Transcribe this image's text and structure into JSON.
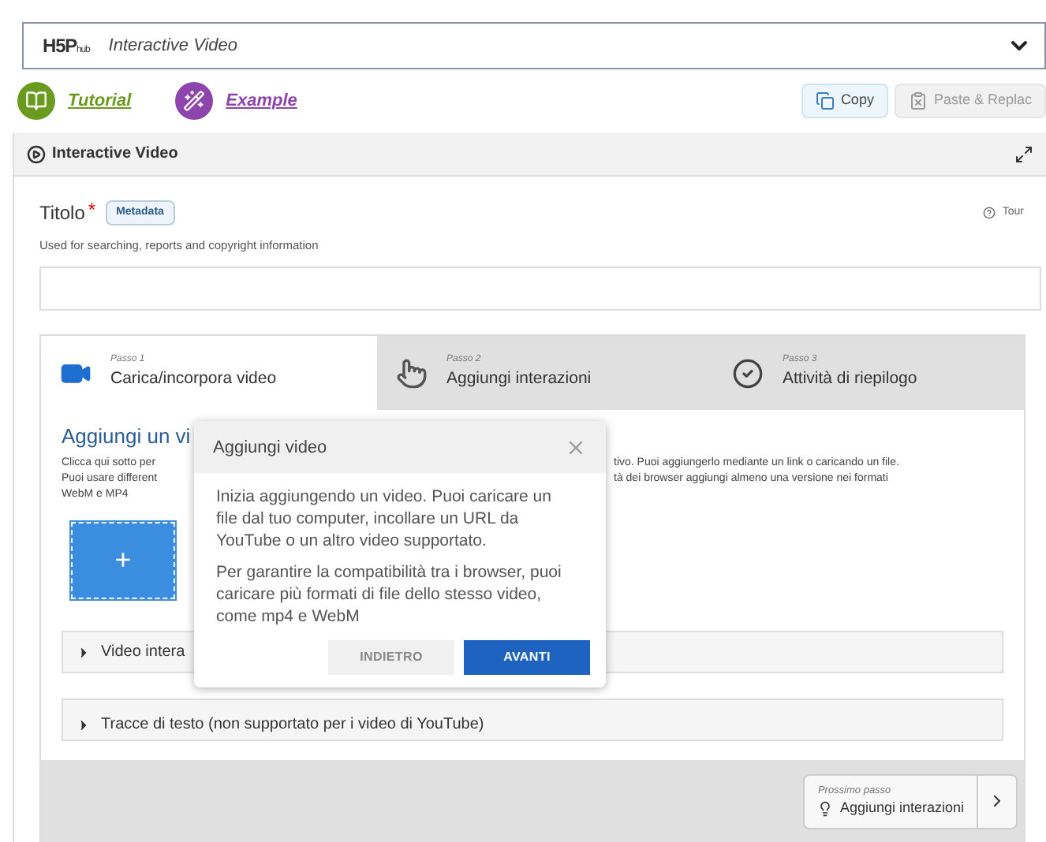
{
  "header": {
    "logo": "H5P",
    "logo_sub": "hub",
    "title": "Interactive Video"
  },
  "links": [
    {
      "label": "Tutorial",
      "kind": "book",
      "color": "#6b9b1e"
    },
    {
      "label": "Example",
      "kind": "wand",
      "color": "#8e44ad"
    }
  ],
  "actions": [
    {
      "label": "Copy",
      "disabled": false
    },
    {
      "label": "Paste & Replac",
      "disabled": true
    }
  ],
  "panel": {
    "title": "Interactive Video"
  },
  "field": {
    "label": "Titolo",
    "required": true,
    "required_mark": "*",
    "badge": "Metadata",
    "tour": "Tour",
    "description": "Used for searching, reports and copyright information"
  },
  "steps": [
    {
      "step": "Passo 1",
      "label": "Carica/incorpora video",
      "kind": "video",
      "selected": true
    },
    {
      "step": "Passo 2",
      "label": "Aggiungi interazioni",
      "kind": "touch",
      "selected": false
    },
    {
      "step": "Passo 3",
      "label": "Attività di riepilogo",
      "kind": "check",
      "selected": false
    }
  ],
  "content": {
    "heading": "Aggiungi un vi",
    "description_lines": [
      {
        "left": "Clicca qui sotto per",
        "right": "tivo. Puoi aggiungerlo mediante un link o caricando un file."
      },
      {
        "left": "Puoi usare different",
        "right": "tà dei browser aggiungi almeno una versione nei formati"
      },
      {
        "left": "WebM e MP4"
      }
    ],
    "add_button": "+",
    "accordions": [
      {
        "label": "Video intera",
        "expanded": false
      },
      {
        "label": "Tracce di testo (non supportato per i video di YouTube)",
        "expanded": false
      }
    ]
  },
  "next_step": {
    "caption": "Prossimo passo",
    "label": "Aggiungi interazioni"
  },
  "popup": {
    "title": "Aggiungi video",
    "paragraphs": [
      "Inizia aggiungendo un video. Puoi caricare un file dal tuo computer, incollare un URL da YouTube o un altro video supportato.",
      "Per garantire la compatibilità tra i browser, puoi caricare più formati di file dello stesso video, come mp4 e WebM"
    ],
    "buttons": [
      {
        "label": "INDIETRO",
        "kind": "secondary"
      },
      {
        "label": "AVANTI",
        "kind": "primary"
      }
    ]
  }
}
